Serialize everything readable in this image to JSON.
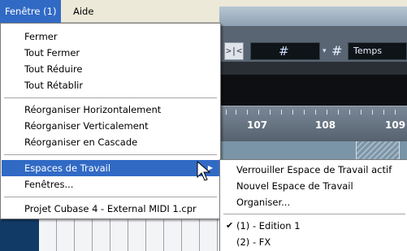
{
  "menubar": {
    "items": [
      {
        "label": "Fenêtre (1)"
      },
      {
        "label": "Aide"
      }
    ]
  },
  "background": {
    "ruler_numbers": [
      "107",
      "108",
      "109"
    ],
    "grid_value": "Temps"
  },
  "window_menu": {
    "items": [
      {
        "label": "Fermer"
      },
      {
        "label": "Tout Fermer"
      },
      {
        "label": "Tout Réduire"
      },
      {
        "label": "Tout Rétablir"
      },
      {
        "label": "Réorganiser Horizontalement"
      },
      {
        "label": "Réorganiser Verticalement"
      },
      {
        "label": "Réorganiser en Cascade"
      },
      {
        "label": "Espaces de Travail"
      },
      {
        "label": "Fenêtres..."
      },
      {
        "label": "Projet Cubase 4 - External MIDI 1.cpr"
      }
    ]
  },
  "workspaces_submenu": {
    "items": [
      {
        "label": "Verrouiller Espace de Travail actif"
      },
      {
        "label": "Nouvel Espace de Travail"
      },
      {
        "label": "Organiser..."
      },
      {
        "label": "(1) - Edition 1",
        "checked": true
      },
      {
        "label": "(2) - FX"
      }
    ]
  },
  "colors": {
    "menu_highlight": "#316ac5",
    "menubar_bg": "#ece9d8"
  },
  "icons": {
    "submenu_arrow": "triangle-right-icon",
    "check": "checkmark-icon",
    "cursor": "arrow-cursor-icon",
    "grid": "grid-hash-icon"
  }
}
